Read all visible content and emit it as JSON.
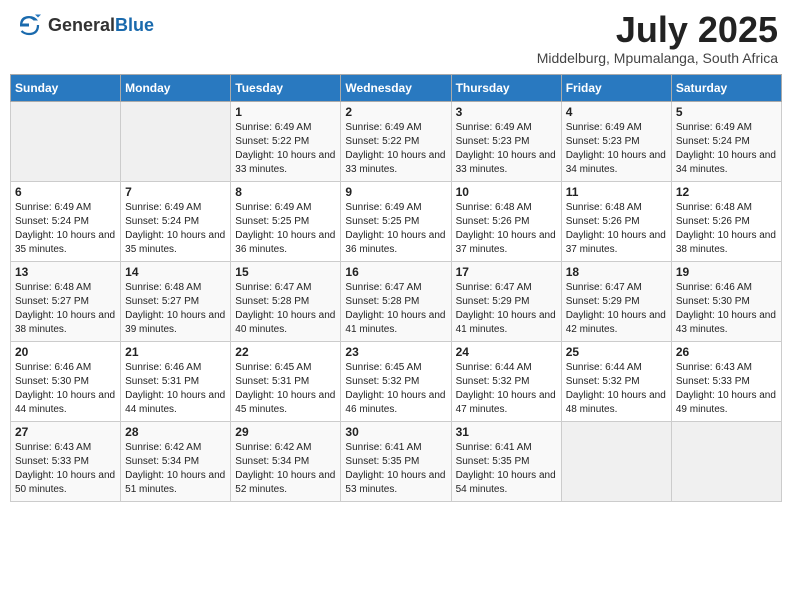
{
  "header": {
    "logo_general": "General",
    "logo_blue": "Blue",
    "month_year": "July 2025",
    "location": "Middelburg, Mpumalanga, South Africa"
  },
  "days_of_week": [
    "Sunday",
    "Monday",
    "Tuesday",
    "Wednesday",
    "Thursday",
    "Friday",
    "Saturday"
  ],
  "weeks": [
    [
      {
        "day": "",
        "empty": true
      },
      {
        "day": "",
        "empty": true
      },
      {
        "day": "1",
        "sunrise": "Sunrise: 6:49 AM",
        "sunset": "Sunset: 5:22 PM",
        "daylight": "Daylight: 10 hours and 33 minutes."
      },
      {
        "day": "2",
        "sunrise": "Sunrise: 6:49 AM",
        "sunset": "Sunset: 5:22 PM",
        "daylight": "Daylight: 10 hours and 33 minutes."
      },
      {
        "day": "3",
        "sunrise": "Sunrise: 6:49 AM",
        "sunset": "Sunset: 5:23 PM",
        "daylight": "Daylight: 10 hours and 33 minutes."
      },
      {
        "day": "4",
        "sunrise": "Sunrise: 6:49 AM",
        "sunset": "Sunset: 5:23 PM",
        "daylight": "Daylight: 10 hours and 34 minutes."
      },
      {
        "day": "5",
        "sunrise": "Sunrise: 6:49 AM",
        "sunset": "Sunset: 5:24 PM",
        "daylight": "Daylight: 10 hours and 34 minutes."
      }
    ],
    [
      {
        "day": "6",
        "sunrise": "Sunrise: 6:49 AM",
        "sunset": "Sunset: 5:24 PM",
        "daylight": "Daylight: 10 hours and 35 minutes."
      },
      {
        "day": "7",
        "sunrise": "Sunrise: 6:49 AM",
        "sunset": "Sunset: 5:24 PM",
        "daylight": "Daylight: 10 hours and 35 minutes."
      },
      {
        "day": "8",
        "sunrise": "Sunrise: 6:49 AM",
        "sunset": "Sunset: 5:25 PM",
        "daylight": "Daylight: 10 hours and 36 minutes."
      },
      {
        "day": "9",
        "sunrise": "Sunrise: 6:49 AM",
        "sunset": "Sunset: 5:25 PM",
        "daylight": "Daylight: 10 hours and 36 minutes."
      },
      {
        "day": "10",
        "sunrise": "Sunrise: 6:48 AM",
        "sunset": "Sunset: 5:26 PM",
        "daylight": "Daylight: 10 hours and 37 minutes."
      },
      {
        "day": "11",
        "sunrise": "Sunrise: 6:48 AM",
        "sunset": "Sunset: 5:26 PM",
        "daylight": "Daylight: 10 hours and 37 minutes."
      },
      {
        "day": "12",
        "sunrise": "Sunrise: 6:48 AM",
        "sunset": "Sunset: 5:26 PM",
        "daylight": "Daylight: 10 hours and 38 minutes."
      }
    ],
    [
      {
        "day": "13",
        "sunrise": "Sunrise: 6:48 AM",
        "sunset": "Sunset: 5:27 PM",
        "daylight": "Daylight: 10 hours and 38 minutes."
      },
      {
        "day": "14",
        "sunrise": "Sunrise: 6:48 AM",
        "sunset": "Sunset: 5:27 PM",
        "daylight": "Daylight: 10 hours and 39 minutes."
      },
      {
        "day": "15",
        "sunrise": "Sunrise: 6:47 AM",
        "sunset": "Sunset: 5:28 PM",
        "daylight": "Daylight: 10 hours and 40 minutes."
      },
      {
        "day": "16",
        "sunrise": "Sunrise: 6:47 AM",
        "sunset": "Sunset: 5:28 PM",
        "daylight": "Daylight: 10 hours and 41 minutes."
      },
      {
        "day": "17",
        "sunrise": "Sunrise: 6:47 AM",
        "sunset": "Sunset: 5:29 PM",
        "daylight": "Daylight: 10 hours and 41 minutes."
      },
      {
        "day": "18",
        "sunrise": "Sunrise: 6:47 AM",
        "sunset": "Sunset: 5:29 PM",
        "daylight": "Daylight: 10 hours and 42 minutes."
      },
      {
        "day": "19",
        "sunrise": "Sunrise: 6:46 AM",
        "sunset": "Sunset: 5:30 PM",
        "daylight": "Daylight: 10 hours and 43 minutes."
      }
    ],
    [
      {
        "day": "20",
        "sunrise": "Sunrise: 6:46 AM",
        "sunset": "Sunset: 5:30 PM",
        "daylight": "Daylight: 10 hours and 44 minutes."
      },
      {
        "day": "21",
        "sunrise": "Sunrise: 6:46 AM",
        "sunset": "Sunset: 5:31 PM",
        "daylight": "Daylight: 10 hours and 44 minutes."
      },
      {
        "day": "22",
        "sunrise": "Sunrise: 6:45 AM",
        "sunset": "Sunset: 5:31 PM",
        "daylight": "Daylight: 10 hours and 45 minutes."
      },
      {
        "day": "23",
        "sunrise": "Sunrise: 6:45 AM",
        "sunset": "Sunset: 5:32 PM",
        "daylight": "Daylight: 10 hours and 46 minutes."
      },
      {
        "day": "24",
        "sunrise": "Sunrise: 6:44 AM",
        "sunset": "Sunset: 5:32 PM",
        "daylight": "Daylight: 10 hours and 47 minutes."
      },
      {
        "day": "25",
        "sunrise": "Sunrise: 6:44 AM",
        "sunset": "Sunset: 5:32 PM",
        "daylight": "Daylight: 10 hours and 48 minutes."
      },
      {
        "day": "26",
        "sunrise": "Sunrise: 6:43 AM",
        "sunset": "Sunset: 5:33 PM",
        "daylight": "Daylight: 10 hours and 49 minutes."
      }
    ],
    [
      {
        "day": "27",
        "sunrise": "Sunrise: 6:43 AM",
        "sunset": "Sunset: 5:33 PM",
        "daylight": "Daylight: 10 hours and 50 minutes."
      },
      {
        "day": "28",
        "sunrise": "Sunrise: 6:42 AM",
        "sunset": "Sunset: 5:34 PM",
        "daylight": "Daylight: 10 hours and 51 minutes."
      },
      {
        "day": "29",
        "sunrise": "Sunrise: 6:42 AM",
        "sunset": "Sunset: 5:34 PM",
        "daylight": "Daylight: 10 hours and 52 minutes."
      },
      {
        "day": "30",
        "sunrise": "Sunrise: 6:41 AM",
        "sunset": "Sunset: 5:35 PM",
        "daylight": "Daylight: 10 hours and 53 minutes."
      },
      {
        "day": "31",
        "sunrise": "Sunrise: 6:41 AM",
        "sunset": "Sunset: 5:35 PM",
        "daylight": "Daylight: 10 hours and 54 minutes."
      },
      {
        "day": "",
        "empty": true
      },
      {
        "day": "",
        "empty": true
      }
    ]
  ]
}
